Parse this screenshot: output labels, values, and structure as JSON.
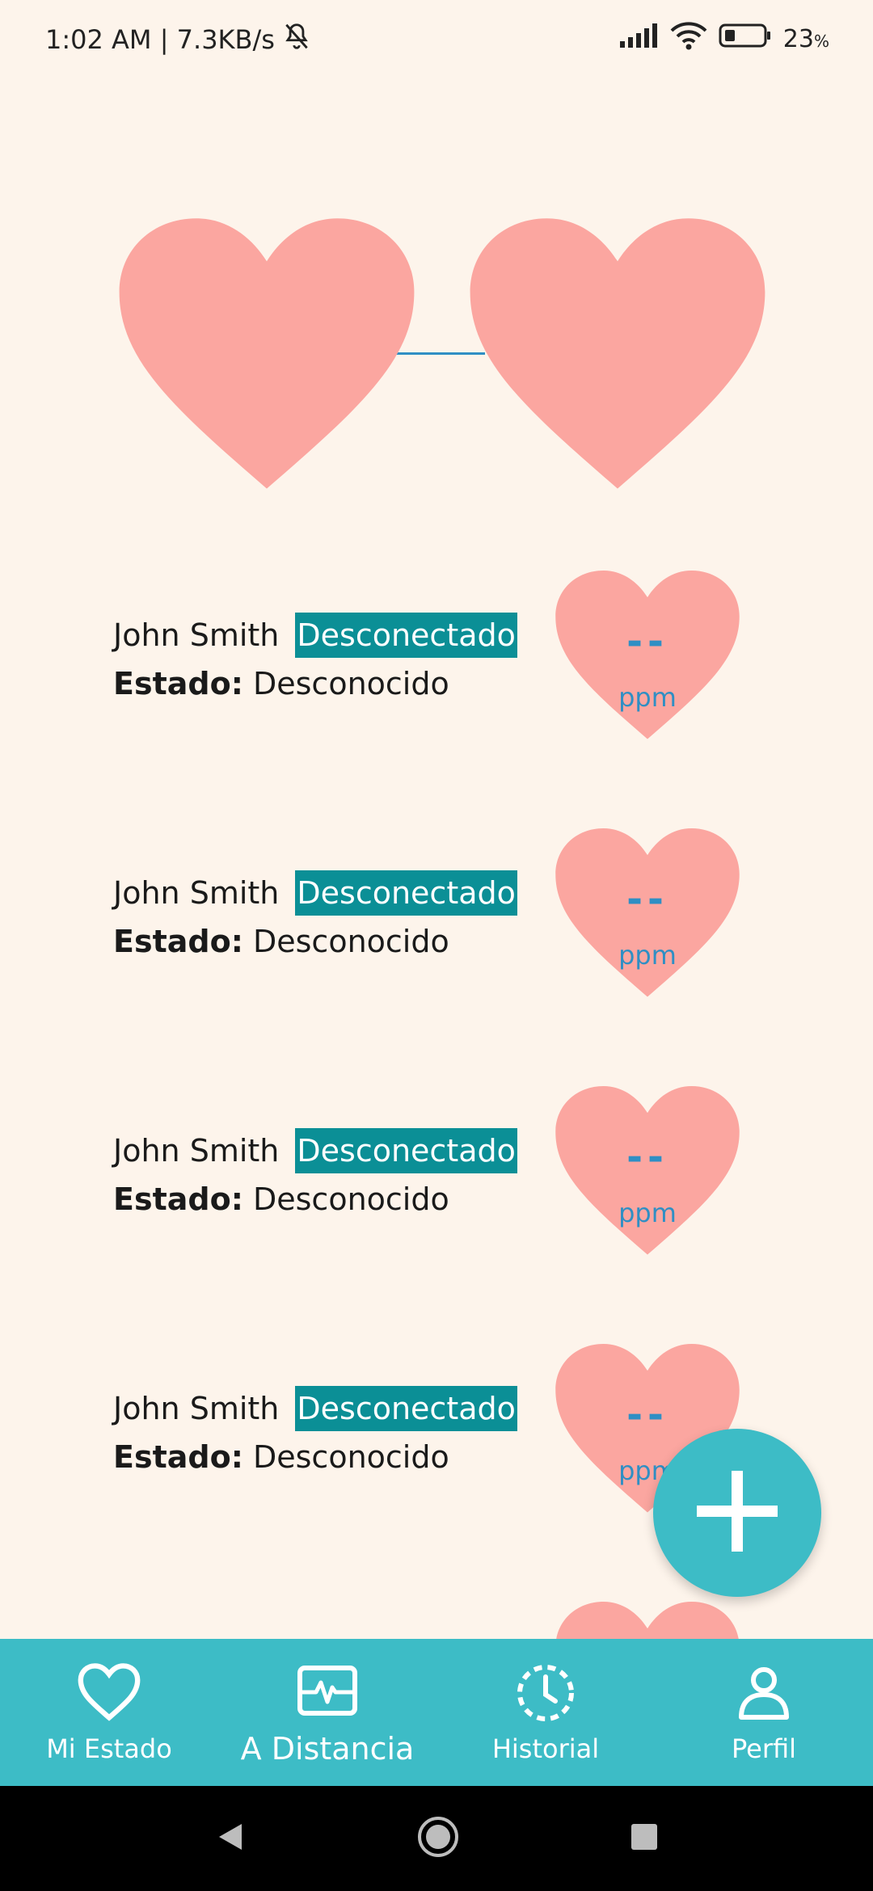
{
  "status_bar": {
    "time_speed": "1:02 AM | 7.3KB/s",
    "battery": "23"
  },
  "colors": {
    "background": "#fdf4eb",
    "heart": "#fba6a0",
    "accent": "#3dbcc6",
    "badge": "#0b8f96",
    "bpm": "#2f8fc4"
  },
  "people": [
    {
      "name": "John Smith",
      "connection": "Desconectado",
      "status_label": "Estado:",
      "status_value": "Desconocido",
      "bpm": "--",
      "unit": "ppm"
    },
    {
      "name": "John Smith",
      "connection": "Desconectado",
      "status_label": "Estado:",
      "status_value": "Desconocido",
      "bpm": "--",
      "unit": "ppm"
    },
    {
      "name": "John Smith",
      "connection": "Desconectado",
      "status_label": "Estado:",
      "status_value": "Desconocido",
      "bpm": "--",
      "unit": "ppm"
    },
    {
      "name": "John Smith",
      "connection": "Desconectado",
      "status_label": "Estado:",
      "status_value": "Desconocido",
      "bpm": "--",
      "unit": "ppm"
    }
  ],
  "fab": {
    "icon": "plus-icon"
  },
  "bottom_nav": [
    {
      "label": "Mi Estado",
      "icon": "heart-icon"
    },
    {
      "label": "A Distancia",
      "icon": "ecg-icon"
    },
    {
      "label": "Historial",
      "icon": "history-icon"
    },
    {
      "label": "Perfil",
      "icon": "person-icon"
    }
  ]
}
